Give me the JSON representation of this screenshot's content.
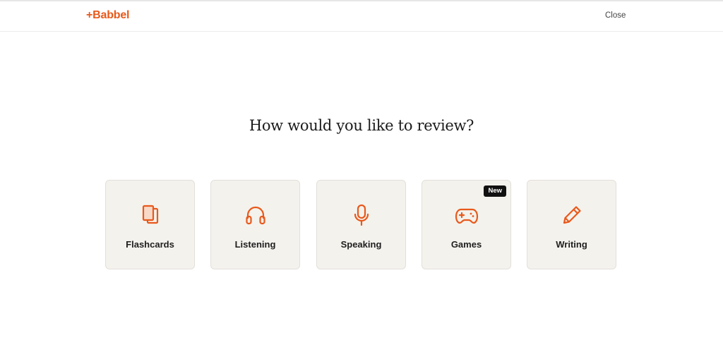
{
  "app": {
    "logo": "+Babbel",
    "close_label": "Close",
    "accent_color": "#e8591b"
  },
  "main": {
    "title": "How would you like to review?",
    "options": [
      {
        "label": "Flashcards",
        "icon": "flashcards-icon"
      },
      {
        "label": "Listening",
        "icon": "headphones-icon"
      },
      {
        "label": "Speaking",
        "icon": "microphone-icon"
      },
      {
        "label": "Games",
        "icon": "gamepad-icon",
        "badge": "New"
      },
      {
        "label": "Writing",
        "icon": "pencil-icon"
      }
    ]
  }
}
